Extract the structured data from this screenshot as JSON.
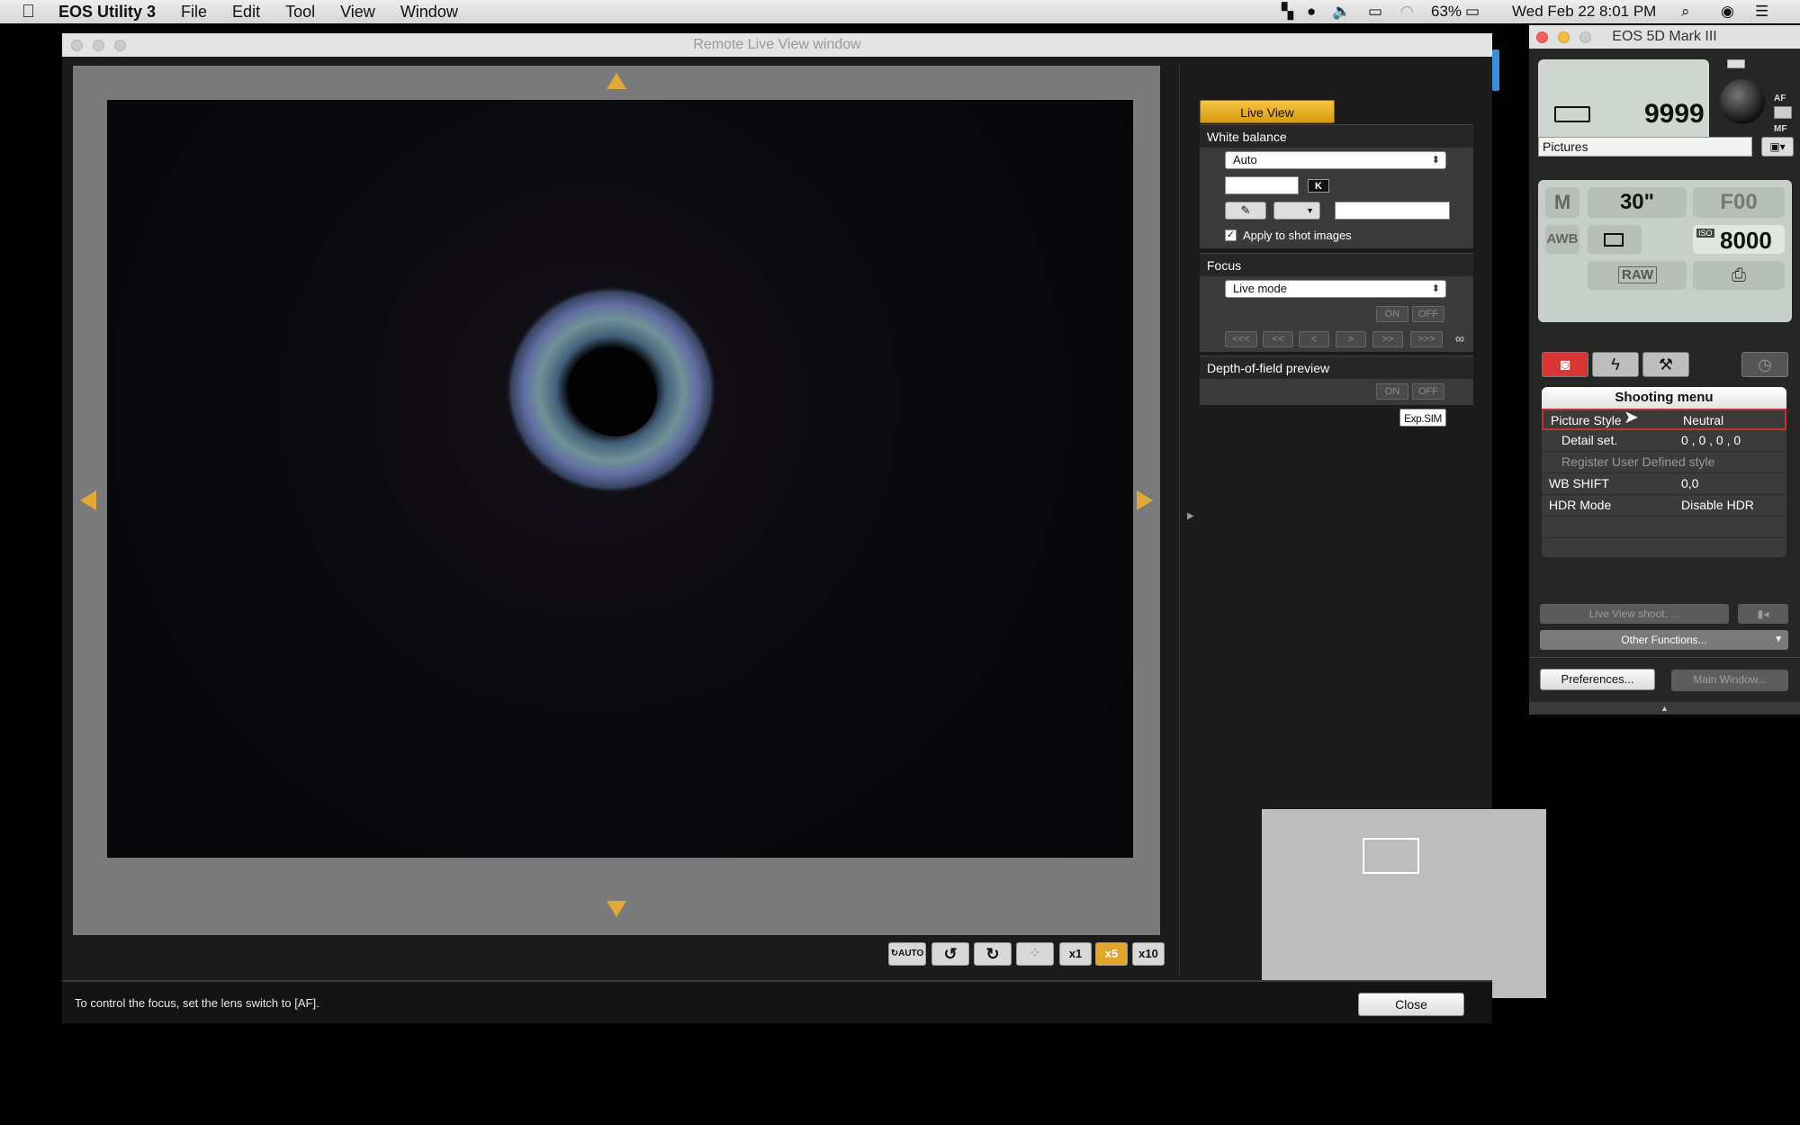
{
  "menubar": {
    "app_name": "EOS Utility 3",
    "menus": [
      "File",
      "Edit",
      "Tool",
      "View",
      "Window"
    ],
    "battery": "63%",
    "datetime": "Wed Feb 22  8:01 PM"
  },
  "remote_window": {
    "title": "Remote Live View window",
    "status_text": "To control the focus, set the lens switch to [AF].",
    "close_label": "Close",
    "zoom_buttons": [
      "x1",
      "x5",
      "x10"
    ],
    "auto_label": "AUTO"
  },
  "side_panel": {
    "live_view_label": "Live View",
    "white_balance": {
      "title": "White balance",
      "mode": "Auto",
      "kelvin_label": "K",
      "apply_label": "Apply to shot images"
    },
    "focus": {
      "title": "Focus",
      "mode": "Live mode",
      "on_label": "ON",
      "off_label": "OFF",
      "step_buttons": [
        "<<<",
        "<<",
        "<",
        ">",
        ">>",
        ">>>"
      ],
      "infinity": "∞"
    },
    "dof": {
      "title": "Depth-of-field preview",
      "on_label": "ON",
      "off_label": "OFF"
    },
    "exp_sim": "Exp.SIM"
  },
  "eos_panel": {
    "title": "EOS 5D Mark III",
    "shots_remaining": "9999",
    "af_label": "AF",
    "mf_label": "MF",
    "folder": "Pictures",
    "mode": "M",
    "shutter": "30\"",
    "aperture": "F00",
    "wb": "AWB",
    "iso_label": "ISO",
    "iso": "8000",
    "quality": "RAW",
    "shooting_menu": {
      "title": "Shooting menu",
      "rows": [
        {
          "label": "Picture Style",
          "value": "Neutral"
        },
        {
          "label": "Detail set.",
          "value": "0 , 0 , 0 , 0"
        },
        {
          "label": "Register User Defined style",
          "value": ""
        },
        {
          "label": "WB SHIFT",
          "value": "0,0"
        },
        {
          "label": "HDR Mode",
          "value": "Disable HDR"
        }
      ]
    },
    "live_view_shoot": "Live View shoot. ...",
    "other_functions": "Other Functions...",
    "preferences": "Preferences...",
    "main_window": "Main Window..."
  }
}
